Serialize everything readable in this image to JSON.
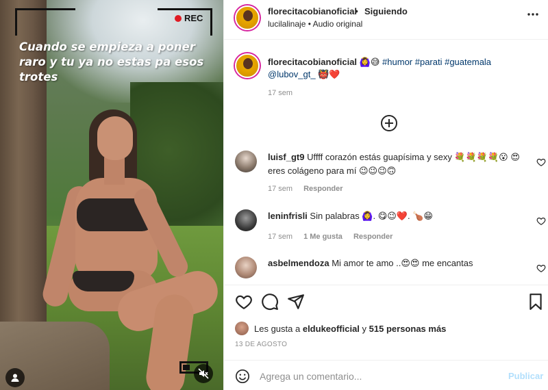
{
  "media": {
    "rec_label": "REC",
    "caption": "Cuando se empieza a poner raro y tu ya no estas pa esos trotes"
  },
  "header": {
    "username": "florecitacobianoficial",
    "separator": "•",
    "follow_status": "Siguiendo",
    "subtitle": "lucilalinaje • Audio original",
    "more_icon": "more-horizontal-icon"
  },
  "post_caption": {
    "username": "florecitacobianoficial",
    "emojis_before": "🙆‍♀️😅",
    "hashtags": "#humor #parati #guatemala",
    "mention": "@lubov_gt_",
    "emojis_after": "👹❤️",
    "time": "17 sem"
  },
  "load_more_icon": "plus-circle-icon",
  "comments": [
    {
      "username": "luisf_gt9",
      "text": "Uffff corazón estás guapísima y sexy 💐💐💐💐😮 😍eres colágeno para mí 😉😉😉🙃",
      "time": "17 sem",
      "likes": "",
      "reply": "Responder"
    },
    {
      "username": "leninfrisli",
      "text": "Sin palabras 🙆‍♀️. 😋😉❤️. 🍗😁",
      "time": "17 sem",
      "likes": "1 Me gusta",
      "reply": "Responder"
    },
    {
      "username": "asbelmendoza",
      "text": "Mi amor te amo ..😍😍 me encantas",
      "time": "",
      "likes": "",
      "reply": ""
    }
  ],
  "likes_summary": {
    "prefix": "Les gusta a",
    "user": "eldukeofficial",
    "conjunction": "y",
    "others": "515 personas más"
  },
  "date": "13 DE AGOSTO",
  "add_comment": {
    "placeholder": "Agrega un comentario...",
    "post_label": "Publicar"
  },
  "colors": {
    "link": "#00376b",
    "muted": "#8e8e8e",
    "post_disabled": "#b2dffc",
    "rec_dot": "#e01b24"
  }
}
